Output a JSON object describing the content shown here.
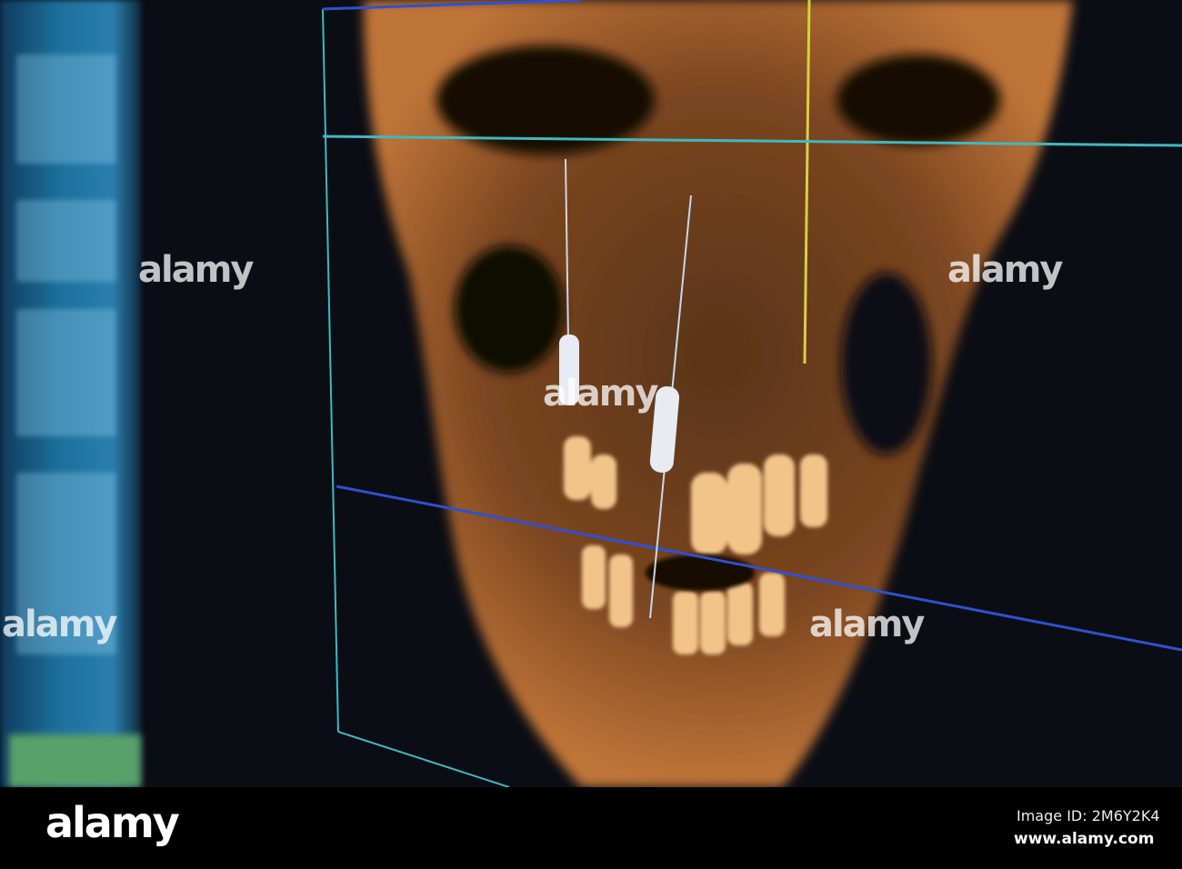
{
  "watermark": {
    "text": "alamy"
  },
  "footer": {
    "logo": "alamy",
    "image_id": "Image ID: 2M6Y2K4",
    "website": "www.alamy.com"
  },
  "colors": {
    "bone": "#c87a3a",
    "axis_cyan": "#3fb8c0",
    "axis_yellow": "#d8d040",
    "axis_blue": "#3050d0"
  }
}
